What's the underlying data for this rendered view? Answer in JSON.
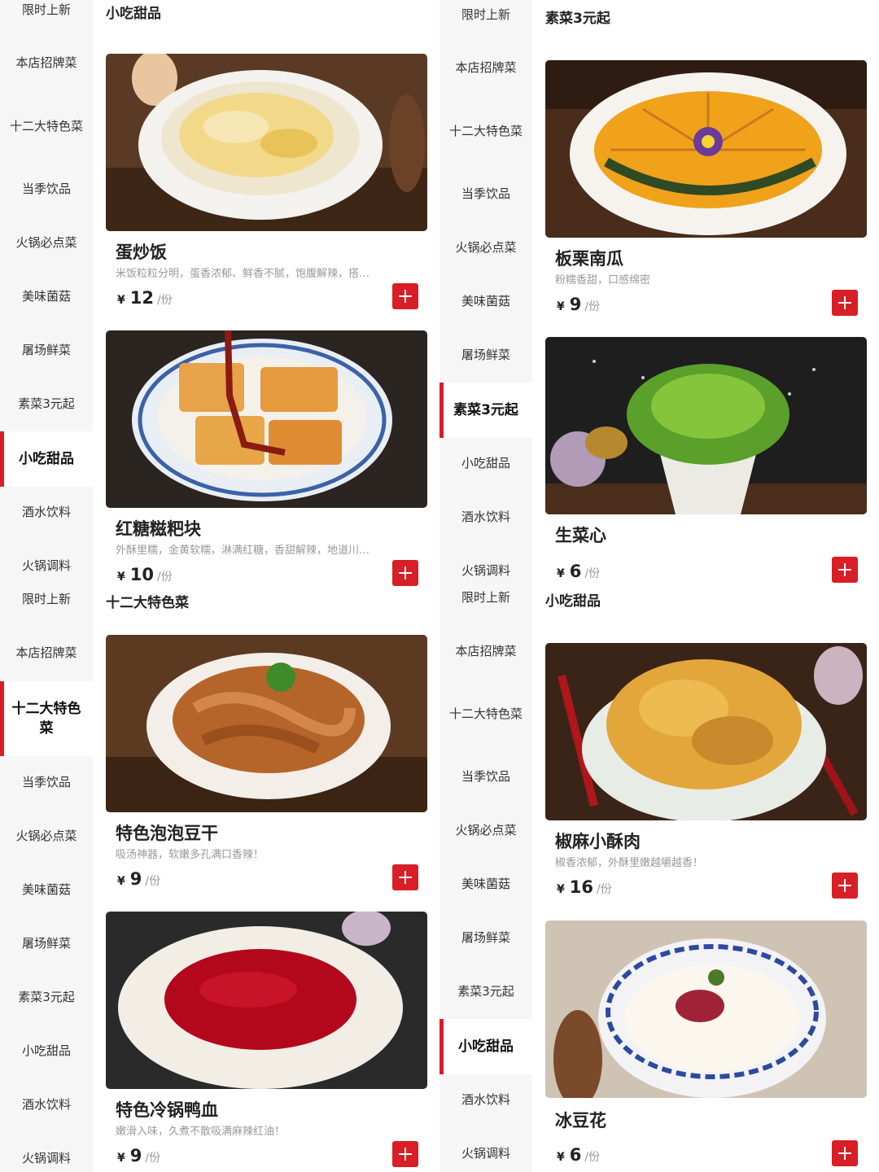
{
  "left": {
    "nav": [
      "限时上新",
      "本店招牌菜",
      "十二大特色菜",
      "当季饮品",
      "火锅必点菜",
      "美味菌菇",
      "屠场鲜菜",
      "素菜3元起",
      "小吃甜品",
      "酒水饮料",
      "火锅调料",
      "限时上新",
      "本店招牌菜",
      "十二大特色菜",
      "当季饮品",
      "火锅必点菜",
      "美味菌菇",
      "屠场鲜菜",
      "素菜3元起",
      "小吃甜品",
      "酒水饮料",
      "火锅调料"
    ],
    "section1": "小吃甜品",
    "section2": "十二大特色菜",
    "dishes": [
      {
        "name": "蛋炒饭",
        "desc": "米饭粒粒分明，蛋香浓郁、鲜香不腻，饱腹解辣，搭…",
        "currency": "¥",
        "price": "12",
        "unit": "/份"
      },
      {
        "name": "红糖糍粑块",
        "desc": "外酥里糯，金黄软糯，淋满红糖，香甜解辣，地道川…",
        "currency": "¥",
        "price": "10",
        "unit": "/份"
      },
      {
        "name": "特色泡泡豆干",
        "desc": "吸汤神器，软嫩多孔满口香辣！",
        "currency": "¥",
        "price": "9",
        "unit": "/份"
      },
      {
        "name": "特色冷锅鸭血",
        "desc": "嫩滑入味，久煮不散吸满麻辣红油！",
        "currency": "¥",
        "price": "9",
        "unit": "/份"
      }
    ]
  },
  "right": {
    "nav": [
      "限时上新",
      "本店招牌菜",
      "十二大特色菜",
      "当季饮品",
      "火锅必点菜",
      "美味菌菇",
      "屠场鲜菜",
      "素菜3元起",
      "小吃甜品",
      "酒水饮料",
      "火锅调料",
      "限时上新",
      "本店招牌菜",
      "十二大特色菜",
      "当季饮品",
      "火锅必点菜",
      "美味菌菇",
      "屠场鲜菜",
      "素菜3元起",
      "小吃甜品",
      "酒水饮料",
      "火锅调料"
    ],
    "section1": "素菜3元起",
    "section2": "小吃甜品",
    "dishes": [
      {
        "name": "板栗南瓜",
        "desc": "粉糯香甜，口感绵密",
        "currency": "¥",
        "price": "9",
        "unit": "/份"
      },
      {
        "name": "生菜心",
        "desc": "",
        "currency": "¥",
        "price": "6",
        "unit": "/份"
      },
      {
        "name": "椒麻小酥肉",
        "desc": "椒香浓郁，外酥里嫩越嚼越香！",
        "currency": "¥",
        "price": "16",
        "unit": "/份"
      },
      {
        "name": "冰豆花",
        "desc": "",
        "currency": "¥",
        "price": "6",
        "unit": "/份"
      }
    ]
  },
  "colors": {
    "accent": "#d81e26",
    "sidebar_bg": "#f6f6f6"
  }
}
